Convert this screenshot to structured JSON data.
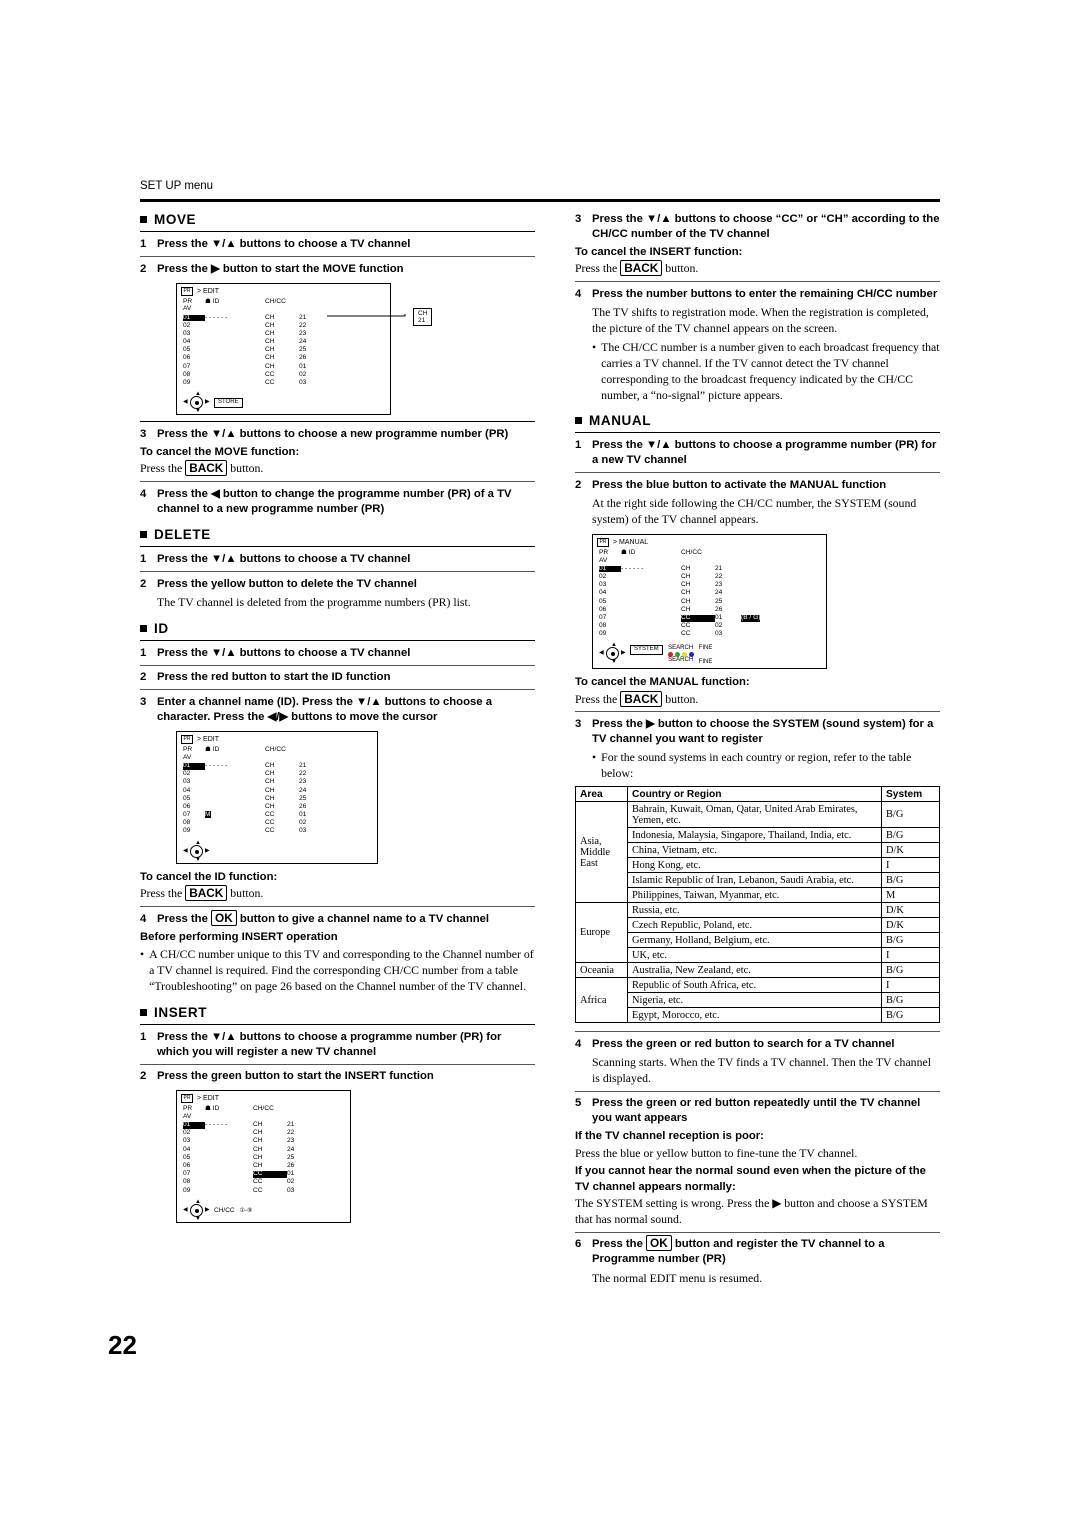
{
  "header": {
    "title": "SET UP menu"
  },
  "page_number": "22",
  "left": {
    "move": {
      "title": "MOVE",
      "steps": [
        {
          "num": "1",
          "text": "Press the ▼/▲ buttons to choose a TV channel"
        },
        {
          "num": "2",
          "text": "Press the ▶ button to start the MOVE function"
        },
        {
          "num": "3",
          "text": "Press the ▼/▲ buttons to choose a new programme number (PR)"
        },
        {
          "num": "4",
          "text": "Press the ◀ button to change the programme number (PR) of a TV channel to a new programme number (PR)"
        }
      ],
      "cancel_title": "To cancel the MOVE function:",
      "cancel_text_pre": "Press the",
      "cancel_key": "BACK",
      "cancel_text_post": "button."
    },
    "delete": {
      "title": "DELETE",
      "steps": [
        {
          "num": "1",
          "text": "Press the ▼/▲ buttons to choose a TV channel"
        },
        {
          "num": "2",
          "text": "Press the yellow button to delete the TV channel"
        }
      ],
      "note": "The TV channel is deleted from the programme numbers (PR) list."
    },
    "id": {
      "title": "ID",
      "steps": [
        {
          "num": "1",
          "text": "Press the ▼/▲ buttons to choose a TV channel"
        },
        {
          "num": "2",
          "text": "Press the red button to start the ID function"
        },
        {
          "num": "3",
          "text": "Enter a channel name (ID). Press the ▼/▲ buttons to choose a character. Press the ◀/▶ buttons to move the cursor"
        }
      ],
      "cancel_title": "To cancel the ID function:",
      "cancel_text_pre": "Press the",
      "cancel_key": "BACK",
      "cancel_text_post": "button.",
      "step4_num": "4",
      "step4_pre": "Press the",
      "step4_key": "OK",
      "step4_post": "button to give a channel name to a TV channel",
      "before_title": "Before performing INSERT operation",
      "before_bullet": "A CH/CC number unique to this TV and corresponding to the Channel number of a TV channel is required. Find the corresponding CH/CC number from a table “Troubleshooting” on page 26 based on the Channel number of the TV channel."
    },
    "insert": {
      "title": "INSERT",
      "steps": [
        {
          "num": "1",
          "text": "Press the ▼/▲ buttons to choose a programme number (PR) for which you will register a new TV channel"
        },
        {
          "num": "2",
          "text": "Press the green button to start the INSERT function"
        }
      ]
    }
  },
  "right": {
    "insert_cont": {
      "step3": {
        "num": "3",
        "text": "Press the ▼/▲ buttons to choose “CC” or “CH” according to the CH/CC number of the TV channel"
      },
      "cancel_title": "To cancel the INSERT function:",
      "cancel_pre": "Press the",
      "cancel_key": "BACK",
      "cancel_post": "button.",
      "step4": {
        "num": "4",
        "text": "Press the number buttons to enter the remaining CH/CC number"
      },
      "para": "The TV shifts to registration mode. When the registration is completed, the picture of the TV channel appears on the screen.",
      "bullet": "The CH/CC number is a number given to each broadcast frequency that carries a TV channel. If the TV cannot detect the TV channel corresponding to the broadcast frequency indicated by the CH/CC number, a “no-signal” picture appears."
    },
    "manual": {
      "title": "MANUAL",
      "steps": [
        {
          "num": "1",
          "text": "Press the ▼/▲ buttons to choose a programme number (PR) for a new TV channel"
        },
        {
          "num": "2",
          "text": "Press the blue button to activate the MANUAL function"
        }
      ],
      "para2": "At the right side following the CH/CC number, the SYSTEM (sound system) of the TV channel appears.",
      "cancel_title": "To cancel the MANUAL function:",
      "cancel_pre": "Press the",
      "cancel_key": "BACK",
      "cancel_post": "button.",
      "step3": {
        "num": "3",
        "text": "Press the ▶ button to choose the SYSTEM (sound system) for a TV channel you want to register"
      },
      "step3_bullet": "For the sound systems in each country or region, refer to the table below:",
      "step4": {
        "num": "4",
        "text": "Press the green or red button to search for a TV channel"
      },
      "step4_para": "Scanning starts. When the TV finds a TV channel. Then the TV channel is displayed.",
      "step5": {
        "num": "5",
        "text": "Press the green or red button repeatedly until the TV channel you want appears"
      },
      "poor_title": "If the TV channel reception is poor:",
      "poor_text": "Press the blue or yellow button to fine-tune the TV channel.",
      "nosound_title": "If you cannot hear the normal sound even when the picture of the TV channel appears normally:",
      "nosound_text": "The SYSTEM setting is wrong. Press the ▶ button and choose a SYSTEM that has normal sound.",
      "step6_num": "6",
      "step6_pre": "Press the",
      "step6_key": "OK",
      "step6_post": "button and register the TV channel to a Programme number (PR)",
      "step6_para": "The normal EDIT menu is resumed."
    },
    "system_table": {
      "headers": [
        "Area",
        "Country or Region",
        "System"
      ],
      "groups": [
        {
          "area": "Asia, Middle East",
          "rows": [
            {
              "country": "Bahrain, Kuwait, Oman, Qatar, United Arab Emirates, Yemen, etc.",
              "system": "B/G"
            },
            {
              "country": "Indonesia, Malaysia, Singapore, Thailand, India, etc.",
              "system": "B/G"
            },
            {
              "country": "China, Vietnam, etc.",
              "system": "D/K"
            },
            {
              "country": "Hong Kong, etc.",
              "system": "I"
            },
            {
              "country": "Islamic Republic of Iran, Lebanon, Saudi Arabia, etc.",
              "system": "B/G"
            },
            {
              "country": "Philippines, Taiwan, Myanmar, etc.",
              "system": "M"
            }
          ]
        },
        {
          "area": "Europe",
          "rows": [
            {
              "country": "Russia, etc.",
              "system": "D/K"
            },
            {
              "country": "Czech Republic, Poland, etc.",
              "system": "D/K"
            },
            {
              "country": "Germany, Holland, Belgium, etc.",
              "system": "B/G"
            },
            {
              "country": "UK, etc.",
              "system": "I"
            }
          ]
        },
        {
          "area": "Oceania",
          "rows": [
            {
              "country": "Australia, New Zealand, etc.",
              "system": "B/G"
            }
          ]
        },
        {
          "area": "Africa",
          "rows": [
            {
              "country": "Republic of South Africa, etc.",
              "system": "I"
            },
            {
              "country": "Nigeria, etc.",
              "system": "B/G"
            },
            {
              "country": "Egypt, Morocco, etc.",
              "system": "B/G"
            }
          ]
        }
      ]
    }
  },
  "osd": {
    "move": {
      "menu_label": "> EDIT",
      "head": {
        "pr": "PR",
        "id": "ID",
        "chcc": "CH/CC"
      },
      "av_label": "AV",
      "rows": [
        {
          "pr": "01",
          "id": "- - - - - -",
          "ch": "CH",
          "num": "21"
        },
        {
          "pr": "02",
          "id": "",
          "ch": "CH",
          "num": "22"
        },
        {
          "pr": "03",
          "id": "",
          "ch": "CH",
          "num": "23"
        },
        {
          "pr": "04",
          "id": "",
          "ch": "CH",
          "num": "24"
        },
        {
          "pr": "05",
          "id": "",
          "ch": "CH",
          "num": "25"
        },
        {
          "pr": "06",
          "id": "",
          "ch": "CH",
          "num": "26"
        },
        {
          "pr": "07",
          "id": "",
          "ch": "CH",
          "num": "01"
        },
        {
          "pr": "08",
          "id": "",
          "ch": "CC",
          "num": "02"
        },
        {
          "pr": "09",
          "id": "",
          "ch": "CC",
          "num": "03"
        }
      ],
      "callout": "CH  21",
      "store_label": "STORE"
    },
    "id": {
      "menu_label": "> EDIT",
      "head": {
        "pr": "PR",
        "id": "ID",
        "chcc": "CH/CC"
      },
      "av_label": "AV",
      "rows": [
        {
          "pr": "01",
          "id": "- - - - - -",
          "ch": "CH",
          "num": "21"
        },
        {
          "pr": "02",
          "id": "",
          "ch": "CH",
          "num": "22"
        },
        {
          "pr": "03",
          "id": "",
          "ch": "CH",
          "num": "23"
        },
        {
          "pr": "04",
          "id": "",
          "ch": "CH",
          "num": "24"
        },
        {
          "pr": "05",
          "id": "",
          "ch": "CH",
          "num": "25"
        },
        {
          "pr": "06",
          "id": "",
          "ch": "CH",
          "num": "26"
        },
        {
          "pr": "07",
          "id": "M",
          "ch": "CC",
          "num": "01"
        },
        {
          "pr": "08",
          "id": "",
          "ch": "CC",
          "num": "02"
        },
        {
          "pr": "09",
          "id": "",
          "ch": "CC",
          "num": "03"
        }
      ]
    },
    "insert": {
      "menu_label": "> EDIT",
      "head": {
        "pr": "PR",
        "id": "ID",
        "chcc": "CH/CC"
      },
      "av_label": "AV",
      "rows": [
        {
          "pr": "01",
          "id": "- - - - - -",
          "ch": "CH",
          "num": "21"
        },
        {
          "pr": "02",
          "id": "",
          "ch": "CH",
          "num": "22"
        },
        {
          "pr": "03",
          "id": "",
          "ch": "CH",
          "num": "23"
        },
        {
          "pr": "04",
          "id": "",
          "ch": "CH",
          "num": "24"
        },
        {
          "pr": "05",
          "id": "",
          "ch": "CH",
          "num": "25"
        },
        {
          "pr": "06",
          "id": "",
          "ch": "CH",
          "num": "26"
        },
        {
          "pr": "07",
          "id": "",
          "ch": "CC",
          "num": "01"
        },
        {
          "pr": "08",
          "id": "",
          "ch": "CC",
          "num": "02"
        },
        {
          "pr": "09",
          "id": "",
          "ch": "CC",
          "num": "03"
        }
      ],
      "bottom_label": "CH/CC"
    },
    "manual": {
      "menu_label": "> MANUAL",
      "head": {
        "pr": "PR",
        "id": "ID",
        "chcc": "CH/CC"
      },
      "av_label": "AV",
      "rows": [
        {
          "pr": "01",
          "id": "- - - - - -",
          "ch": "CH",
          "num": "21",
          "sys": ""
        },
        {
          "pr": "02",
          "id": "",
          "ch": "CH",
          "num": "22",
          "sys": ""
        },
        {
          "pr": "03",
          "id": "",
          "ch": "CH",
          "num": "23",
          "sys": ""
        },
        {
          "pr": "04",
          "id": "",
          "ch": "CH",
          "num": "24",
          "sys": ""
        },
        {
          "pr": "05",
          "id": "",
          "ch": "CH",
          "num": "25",
          "sys": ""
        },
        {
          "pr": "06",
          "id": "",
          "ch": "CH",
          "num": "26",
          "sys": ""
        },
        {
          "pr": "07",
          "id": "",
          "ch": "CC",
          "num": "01",
          "sys": "(B / G)"
        },
        {
          "pr": "08",
          "id": "",
          "ch": "CC",
          "num": "02",
          "sys": ""
        },
        {
          "pr": "09",
          "id": "",
          "ch": "CC",
          "num": "03",
          "sys": ""
        }
      ],
      "system_label": "SYSTEM",
      "search_label": "SEARCH",
      "fine_label": "FINE"
    }
  }
}
